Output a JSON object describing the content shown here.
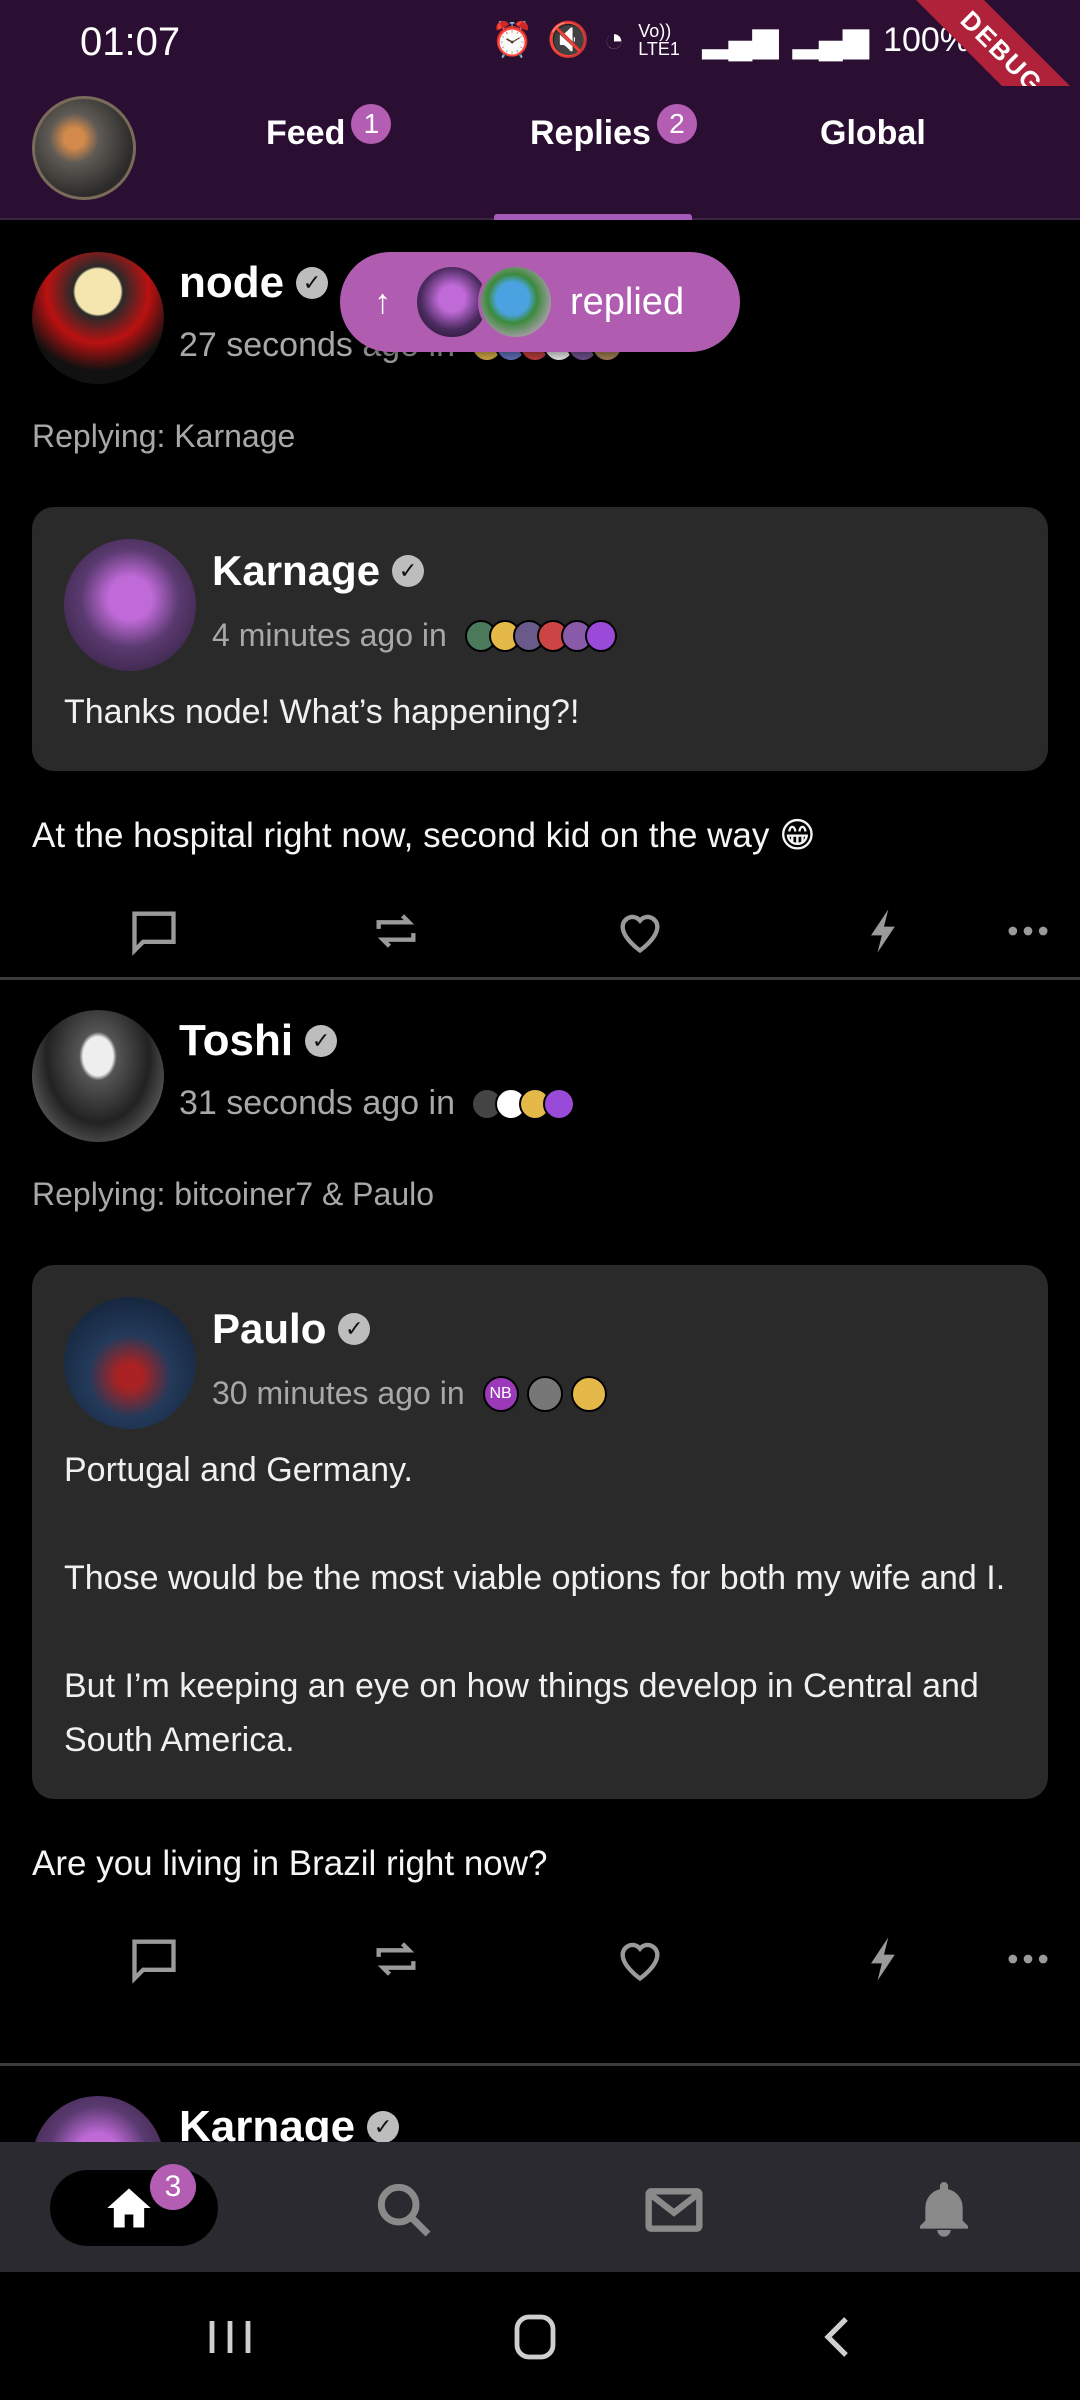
{
  "status_bar": {
    "time": "01:07",
    "battery": "100%",
    "network": "Vo)) LTE1",
    "debug_label": "DEBUG"
  },
  "tabs": [
    {
      "label": "Feed",
      "badge": "1"
    },
    {
      "label": "Replies",
      "badge": "2",
      "active": true
    },
    {
      "label": "Global",
      "badge": ""
    }
  ],
  "replied_pill": {
    "arrow": "↑",
    "label": "replied"
  },
  "posts": [
    {
      "author": "node",
      "time": "27 seconds ago in",
      "replying": "Replying: Karnage",
      "quote": {
        "author": "Karnage",
        "time": "4 minutes ago in",
        "text": "Thanks node! What’s happening?!"
      },
      "text": "At the hospital right now, second kid on the way 😁"
    },
    {
      "author": "Toshi",
      "time": "31 seconds ago in",
      "replying": "Replying: bitcoiner7 & Paulo",
      "quote": {
        "author": "Paulo",
        "time": "30 minutes ago in",
        "text": "Portugal and Germany.\n\nThose would be the most viable options for both my wife and I.\n\nBut I’m keeping an eye on how things develop in Central and South America."
      },
      "text": "Are you living in Brazil right now?"
    },
    {
      "author": "Karnage"
    }
  ],
  "bottom_nav": {
    "home_badge": "3"
  },
  "group_initials": "NB",
  "colors": {
    "header_bg": "#2a0f33",
    "accent": "#b35db3",
    "card_bg": "#2a2a2a"
  }
}
